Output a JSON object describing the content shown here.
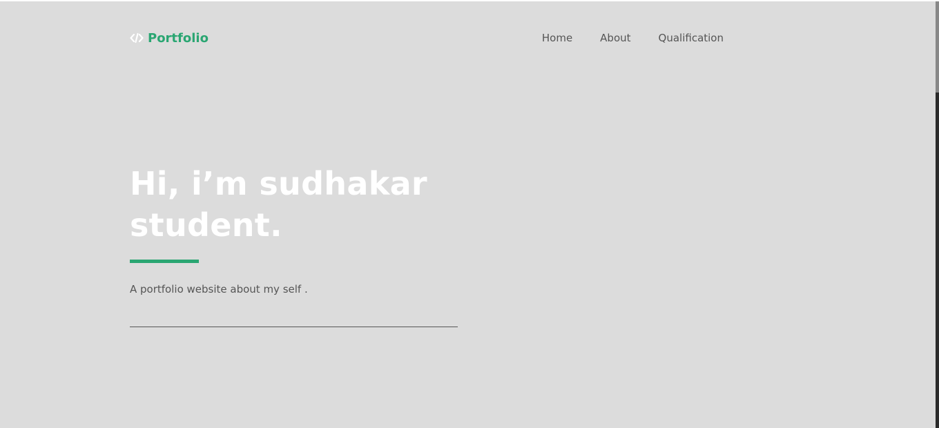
{
  "header": {
    "logo_text": "Portfolio",
    "logo_icon": "code-icon",
    "nav": [
      {
        "label": "Home"
      },
      {
        "label": "About"
      },
      {
        "label": "Qualification"
      }
    ]
  },
  "hero": {
    "title_line1": "Hi, i’m sudhakar",
    "title_line2": "student.",
    "description": "A portfolio website about my self ."
  },
  "colors": {
    "background": "#dcdcdc",
    "accent": "#2aa672",
    "text_muted": "#555555",
    "title": "#ffffff"
  }
}
